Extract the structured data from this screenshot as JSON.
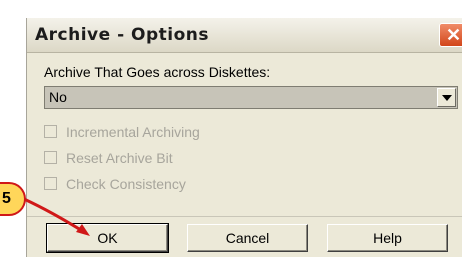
{
  "dialog": {
    "title": "Archive - Options",
    "close_glyph": "✕"
  },
  "archive_select": {
    "label": "Archive That Goes across Diskettes:",
    "value": "No"
  },
  "checkboxes": [
    {
      "label": "Incremental Archiving",
      "checked": false,
      "enabled": false
    },
    {
      "label": "Reset Archive Bit",
      "checked": false,
      "enabled": false
    },
    {
      "label": "Check Consistency",
      "checked": false,
      "enabled": false
    }
  ],
  "buttons": {
    "ok": "OK",
    "cancel": "Cancel",
    "help": "Help"
  },
  "annotation": {
    "step_number": "5",
    "colors": {
      "badge_fill": "#ffd65a",
      "arrow": "#d01818"
    }
  }
}
